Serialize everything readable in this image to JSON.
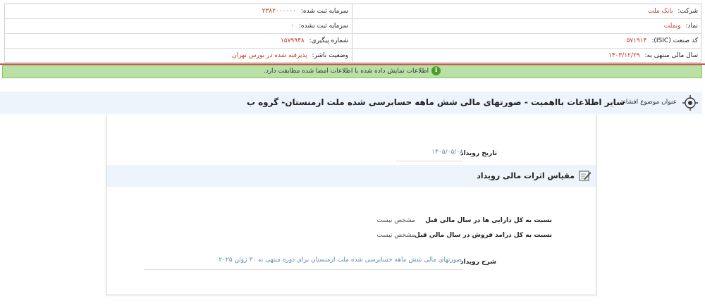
{
  "company_info": {
    "company_label": "شرکت:",
    "company_value": "بانک ملت",
    "symbol_label": "نماد:",
    "symbol_value": "وبملت",
    "isic_label": "کد صنعت (ISIC):",
    "isic_value": "۵۷۱۹۱۴",
    "fiscal_year_label": "سال مالی منتهی به:",
    "fiscal_year_value": "۱۴۰۳/۱۲/۲۹",
    "registered_capital_label": "سرمایه ثبت شده:",
    "registered_capital_value": "۲۳۸۲۰۰۰۰۰۰",
    "unregistered_capital_label": "سرمایه ثبت نشده:",
    "unregistered_capital_value": "۰",
    "tracking_number_label": "شماره پیگیری:",
    "tracking_number_value": "۱۵۷۹۹۴۸",
    "publisher_status_label": "وضعیت ناشر:",
    "publisher_status_value": "پذیرفته شده در بورس تهران"
  },
  "banner": {
    "text": "اطلاعات نمایش داده شده با اطلاعات امضا شده مطابقت دارد."
  },
  "subject": {
    "label": "عنوان موضوع افشاء:",
    "title": "سایر اطلاعات بااهمیت - صورتهای مالی شش ماهه حسابرسی شده ملت ارمنستان- گروه ب"
  },
  "event": {
    "date_label": "تاریخ رویداد",
    "date_value": "۱۴۰۵/۰۵/۰۸",
    "section_title": "مقیاس اثرات مالی رویداد",
    "assets_ratio_label": "نسبت به کل دارایی ها در سال مالی قبل",
    "assets_ratio_value": "مشخص نیست",
    "revenue_ratio_label": "نسبت به کل درامد فروش در سال مالی قبل",
    "revenue_ratio_value": "مشخص نیست",
    "description_label": "شرح رویداد",
    "description_value": "صورتهای مالی شش ماهه حسابرسی شده ملت ارمنستان برای دوره منتهی به ۳۰ ژوئن ۲۰۲۵"
  },
  "colors": {
    "value_red": "#c0392b",
    "banner_green": "#b9e0a5",
    "link_blue": "#5b8db8"
  }
}
